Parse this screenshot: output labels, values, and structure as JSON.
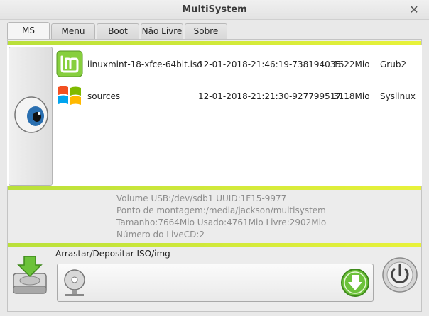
{
  "window": {
    "title": "MultiSystem",
    "close_label": "✕"
  },
  "tabs": [
    {
      "label": "MS"
    },
    {
      "label": "Menu"
    },
    {
      "label": "Boot"
    },
    {
      "label": "Não Livre"
    },
    {
      "label": "Sobre"
    }
  ],
  "entries": [
    {
      "icon": "linux-mint-logo-icon",
      "name": "linuxmint-18-xfce-64bit.iso",
      "date": "12-01-2018-21:46:19-738194035",
      "size": "1622Mio",
      "bootloader": "Grub2"
    },
    {
      "icon": "windows-logo-icon",
      "name": "sources",
      "date": "12-01-2018-21:21:30-927799517",
      "size": "3118Mio",
      "bootloader": "Syslinux"
    }
  ],
  "info": {
    "volume": "Volume USB:/dev/sdb1 UUID:1F15-9977",
    "mount": "Ponto de montagem:/media/jackson/multisystem",
    "size": "Tamanho:7664Mio Usado:4761Mio Livre:2902Mio",
    "livecd": "Número do LiveCD:2"
  },
  "drop": {
    "label": "Arrastar/Depositar ISO/img"
  },
  "colors": {
    "accent_green": "#c6e83a",
    "eye_iris": "#2a6fb0",
    "download_green": "#6cc23a"
  },
  "icons": {
    "eye": "eye-icon",
    "hdd": "hard-drive-install-icon",
    "cd": "cd-drive-icon",
    "download": "download-arrow-icon",
    "power": "power-icon"
  }
}
